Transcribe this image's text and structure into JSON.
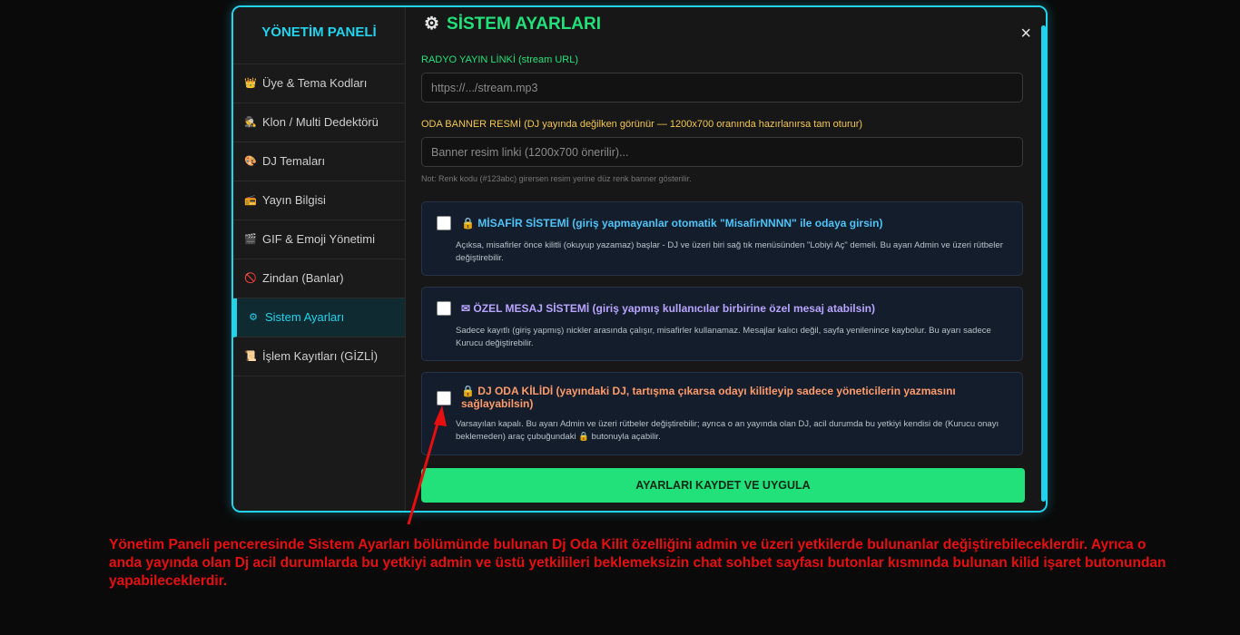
{
  "sidebar": {
    "title": "YÖNETİM PANELİ",
    "items": [
      {
        "icon": "👑",
        "label": "Üye & Tema Kodları"
      },
      {
        "icon": "🕵",
        "label": "Klon / Multi Dedektörü"
      },
      {
        "icon": "🎨",
        "label": "DJ Temaları"
      },
      {
        "icon": "📻",
        "label": "Yayın Bilgisi"
      },
      {
        "icon": "🎬",
        "label": "GIF & Emoji Yönetimi"
      },
      {
        "icon": "🚫",
        "label": "Zindan (Banlar)"
      },
      {
        "icon": "⚙",
        "label": "Sistem Ayarları"
      },
      {
        "icon": "📜",
        "label": "İşlem Kayıtları (GİZLİ)"
      }
    ],
    "active_index": 6
  },
  "main": {
    "title": "SİSTEM AYARLARI",
    "close_symbol": "×",
    "radio_label": "RADYO YAYIN LİNKİ (stream URL)",
    "radio_placeholder": "https://.../stream.mp3",
    "banner_label": "ODA BANNER RESMİ (DJ yayında değilken görünür — 1200x700 oranında hazırlanırsa tam oturur)",
    "banner_placeholder": "Banner resim linki (1200x700 önerilir)...",
    "banner_note": "Not: Renk kodu (#123abc) girersen resim yerine düz renk banner gösterilir.",
    "cards": [
      {
        "icon": "🔒",
        "title": "MİSAFİR SİSTEMİ (giriş yapmayanlar otomatik \"MisafirNNNN\" ile odaya girsin)",
        "title_color": "#4fc3f7",
        "checked": false,
        "description": "Açıksa, misafirler önce kilitli (okuyup yazamaz) başlar - DJ ve üzeri biri sağ tık menüsünden \"Lobiyi Aç\" demeli. Bu ayarı Admin ve üzeri rütbeler değiştirebilir."
      },
      {
        "icon": "✉",
        "title": "ÖZEL MESAJ SİSTEMİ (giriş yapmış kullanıcılar birbirine özel mesaj atabilsin)",
        "title_color": "#b9a5ff",
        "checked": false,
        "description": "Sadece kayıtlı (giriş yapmış) nickler arasında çalışır, misafirler kullanamaz. Mesajlar kalıcı değil, sayfa yenilenince kaybolur. Bu ayarı sadece Kurucu değiştirebilir."
      },
      {
        "icon": "🔒",
        "title": "DJ ODA KİLİDİ (yayındaki DJ, tartışma çıkarsa odayı kilitleyip sadece yöneticilerin yazmasını sağlayabilsin)",
        "title_color": "#ff9b6b",
        "checked": false,
        "description": "Varsayılan kapalı. Bu ayarı Admin ve üzeri rütbeler değiştirebilir; ayrıca o an yayında olan DJ, acil durumda bu yetkiyi kendisi de (Kurucu onayı beklemeden) araç çubuğundaki 🔒 butonuyla açabilir."
      }
    ],
    "save_label": "AYARLARI KAYDET VE UYGULA"
  },
  "annotation": {
    "text": "Yönetim Paneli penceresinde Sistem Ayarları bölümünde bulunan Dj Oda Kilit özelliğini admin ve üzeri yetkilerde bulunanlar değiştirebileceklerdir. Ayrıca o anda yayında olan Dj acil durumlarda bu yetkiyi admin ve üstü yetkilileri beklemeksizin chat sohbet sayfası butonlar kısmında bulunan kilid işaret butonundan yapabileceklerdir.",
    "color": "#e60f0f"
  },
  "colors": {
    "accent": "#22d3ee",
    "primary_green": "#22e07a",
    "label_yellow": "#f3c74f"
  }
}
